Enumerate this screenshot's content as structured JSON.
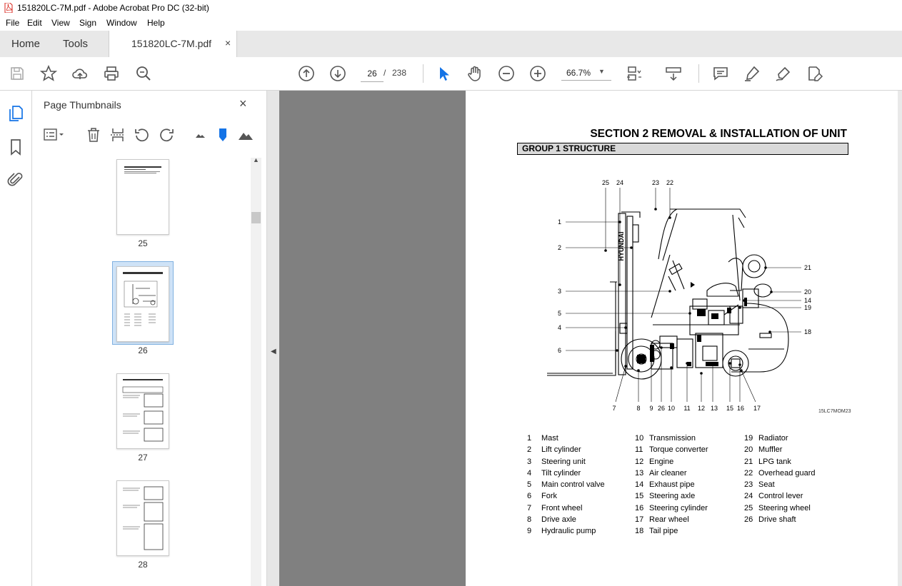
{
  "window": {
    "title": "151820LC-7M.pdf - Adobe Acrobat Pro DC (32-bit)"
  },
  "menu": [
    "File",
    "Edit",
    "View",
    "Sign",
    "Window",
    "Help"
  ],
  "tabs": {
    "home": "Home",
    "tools": "Tools",
    "document": "151820LC-7M.pdf",
    "close": "×"
  },
  "toolbar": {
    "page_current": "26",
    "page_separator": "/",
    "page_total": "238",
    "zoom": "66.7%"
  },
  "thumbnails": {
    "title": "Page Thumbnails",
    "close": "×",
    "pages": [
      {
        "label": "25",
        "selected": false
      },
      {
        "label": "26",
        "selected": true
      },
      {
        "label": "27",
        "selected": false
      },
      {
        "label": "28",
        "selected": false
      }
    ]
  },
  "document": {
    "section_title": "SECTION  2  REMOVAL & INSTALLATION OF UNIT",
    "group_title": "GROUP  1  STRUCTURE",
    "figure_code": "15LC7MOM23",
    "diagram_brand": "HYUNDAI",
    "callouts_top": [
      "25",
      "24",
      "23",
      "22"
    ],
    "callouts_left": [
      "1",
      "2",
      "3",
      "5",
      "4",
      "6"
    ],
    "callouts_right": [
      "21",
      "20",
      "14",
      "19",
      "18"
    ],
    "callouts_bottom": [
      "7",
      "8",
      "9",
      "26",
      "10",
      "11",
      "12",
      "13",
      "15",
      "16",
      "17"
    ],
    "parts": [
      [
        {
          "num": "1",
          "name": "Mast"
        },
        {
          "num": "2",
          "name": "Lift cylinder"
        },
        {
          "num": "3",
          "name": "Steering unit"
        },
        {
          "num": "4",
          "name": "Tilt cylinder"
        },
        {
          "num": "5",
          "name": "Main control valve"
        },
        {
          "num": "6",
          "name": "Fork"
        },
        {
          "num": "7",
          "name": "Front wheel"
        },
        {
          "num": "8",
          "name": "Drive axle"
        },
        {
          "num": "9",
          "name": "Hydraulic pump"
        }
      ],
      [
        {
          "num": "10",
          "name": "Transmission"
        },
        {
          "num": "11",
          "name": "Torque converter"
        },
        {
          "num": "12",
          "name": "Engine"
        },
        {
          "num": "13",
          "name": "Air cleaner"
        },
        {
          "num": "14",
          "name": "Exhaust pipe"
        },
        {
          "num": "15",
          "name": "Steering axle"
        },
        {
          "num": "16",
          "name": "Steering cylinder"
        },
        {
          "num": "17",
          "name": "Rear wheel"
        },
        {
          "num": "18",
          "name": "Tail pipe"
        }
      ],
      [
        {
          "num": "19",
          "name": "Radiator"
        },
        {
          "num": "20",
          "name": "Muffler"
        },
        {
          "num": "21",
          "name": "LPG tank"
        },
        {
          "num": "22",
          "name": "Overhead guard"
        },
        {
          "num": "23",
          "name": "Seat"
        },
        {
          "num": "24",
          "name": "Control lever"
        },
        {
          "num": "25",
          "name": "Steering wheel"
        },
        {
          "num": "26",
          "name": "Drive shaft"
        }
      ]
    ]
  }
}
